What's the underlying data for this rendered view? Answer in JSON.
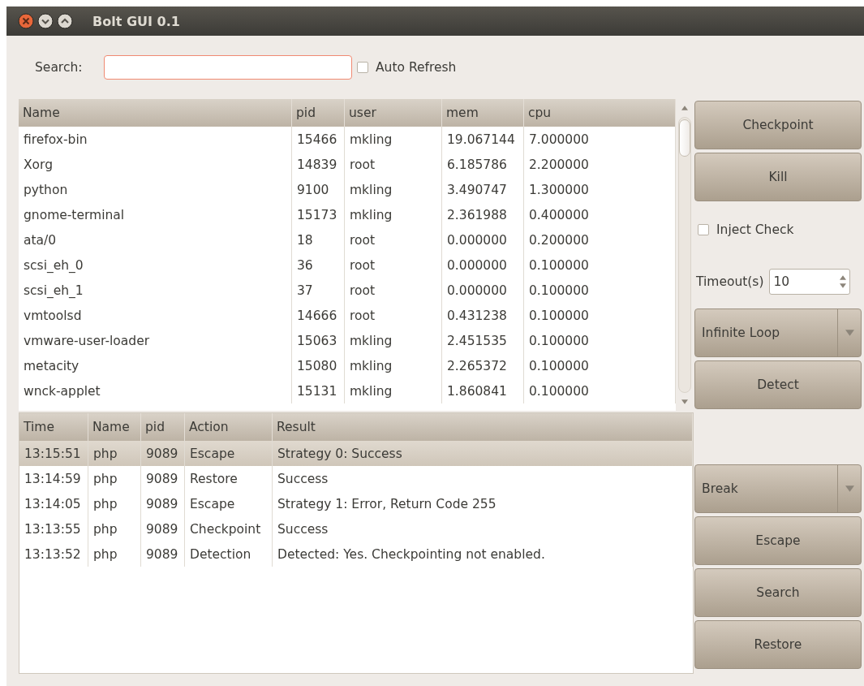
{
  "window": {
    "title": "Bolt GUI 0.1"
  },
  "search": {
    "label": "Search:"
  },
  "auto_refresh": {
    "label": "Auto Refresh",
    "checked": false
  },
  "processes": {
    "columns": [
      "Name",
      "pid",
      "user",
      "mem",
      "cpu"
    ],
    "rows": [
      [
        "firefox-bin",
        "15466",
        "mkling",
        "19.067144",
        "7.000000"
      ],
      [
        "Xorg",
        "14839",
        "root",
        "6.185786",
        "2.200000"
      ],
      [
        "python",
        "9100",
        "mkling",
        "3.490747",
        "1.300000"
      ],
      [
        "gnome-terminal",
        "15173",
        "mkling",
        "2.361988",
        "0.400000"
      ],
      [
        "ata/0",
        "18",
        "root",
        "0.000000",
        "0.200000"
      ],
      [
        "scsi_eh_0",
        "36",
        "root",
        "0.000000",
        "0.100000"
      ],
      [
        "scsi_eh_1",
        "37",
        "root",
        "0.000000",
        "0.100000"
      ],
      [
        "vmtoolsd",
        "14666",
        "root",
        "0.431238",
        "0.100000"
      ],
      [
        "vmware-user-loader",
        "15063",
        "mkling",
        "2.451535",
        "0.100000"
      ],
      [
        "metacity",
        "15080",
        "mkling",
        "2.265372",
        "0.100000"
      ],
      [
        "wnck-applet",
        "15131",
        "mkling",
        "1.860841",
        "0.100000"
      ]
    ]
  },
  "log": {
    "columns": [
      "Time",
      "Name",
      "pid",
      "Action",
      "Result"
    ],
    "rows": [
      {
        "cells": [
          "13:15:51",
          "php",
          "9089",
          "Escape",
          "Strategy 0: Success"
        ],
        "selected": true
      },
      {
        "cells": [
          "13:14:59",
          "php",
          "9089",
          "Restore",
          "Success"
        ],
        "selected": false
      },
      {
        "cells": [
          "13:14:05",
          "php",
          "9089",
          "Escape",
          "Strategy 1: Error, Return Code 255"
        ],
        "selected": false
      },
      {
        "cells": [
          "13:13:55",
          "php",
          "9089",
          "Checkpoint",
          "Success"
        ],
        "selected": false
      },
      {
        "cells": [
          "13:13:52",
          "php",
          "9089",
          "Detection",
          "Detected: Yes. Checkpointing not enabled."
        ],
        "selected": false
      }
    ]
  },
  "actions_top": [
    {
      "kind": "button",
      "label": "Checkpoint"
    },
    {
      "kind": "button",
      "label": "Kill"
    },
    {
      "kind": "checkbox",
      "label": "Inject Check",
      "checked": false
    },
    {
      "kind": "spinner",
      "label": "Timeout(s)",
      "value": "10"
    },
    {
      "kind": "combo",
      "label": "Infinite Loop"
    },
    {
      "kind": "button",
      "label": "Detect"
    }
  ],
  "actions_bottom": [
    {
      "kind": "combo",
      "label": "Break"
    },
    {
      "kind": "button",
      "label": "Escape"
    },
    {
      "kind": "button",
      "label": "Search"
    },
    {
      "kind": "button",
      "label": "Restore"
    }
  ]
}
